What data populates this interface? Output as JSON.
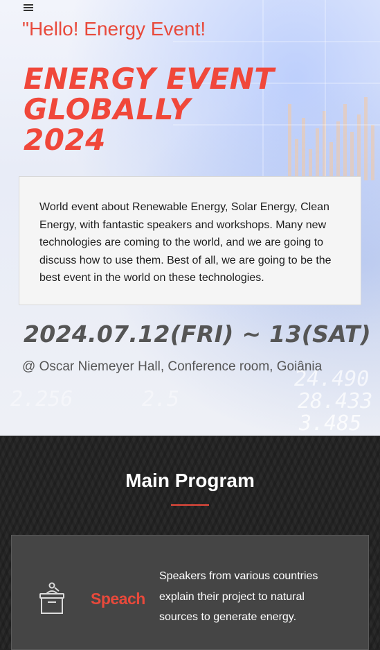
{
  "hero": {
    "greeting": "\"Hello! Energy Event!",
    "headline_lines": [
      "ENERGY EVENT",
      "GLOBALLY",
      "2024"
    ],
    "description": "World event about Renewable Energy, Solar Energy, Clean Energy, with fantastic speakers and workshops. Many new technologies are coming to the world, and we are going to discuss how to use them. Best of all, we are going to be the best event in the world on these technologies.",
    "date": "2024.07.12(FRI) ~ 13(SAT)",
    "venue": "@ Oscar Niemeyer Hall, Conference room, Goiânia"
  },
  "main_program": {
    "title": "Main Program",
    "cards": [
      {
        "icon": "podium-icon",
        "label": "Speach",
        "text": "Speakers from various countries explain their project to natural sources to generate energy."
      }
    ]
  },
  "colors": {
    "accent": "#e8493b",
    "dark_bg": "#2a2a2a",
    "card_bg": "#454545"
  }
}
